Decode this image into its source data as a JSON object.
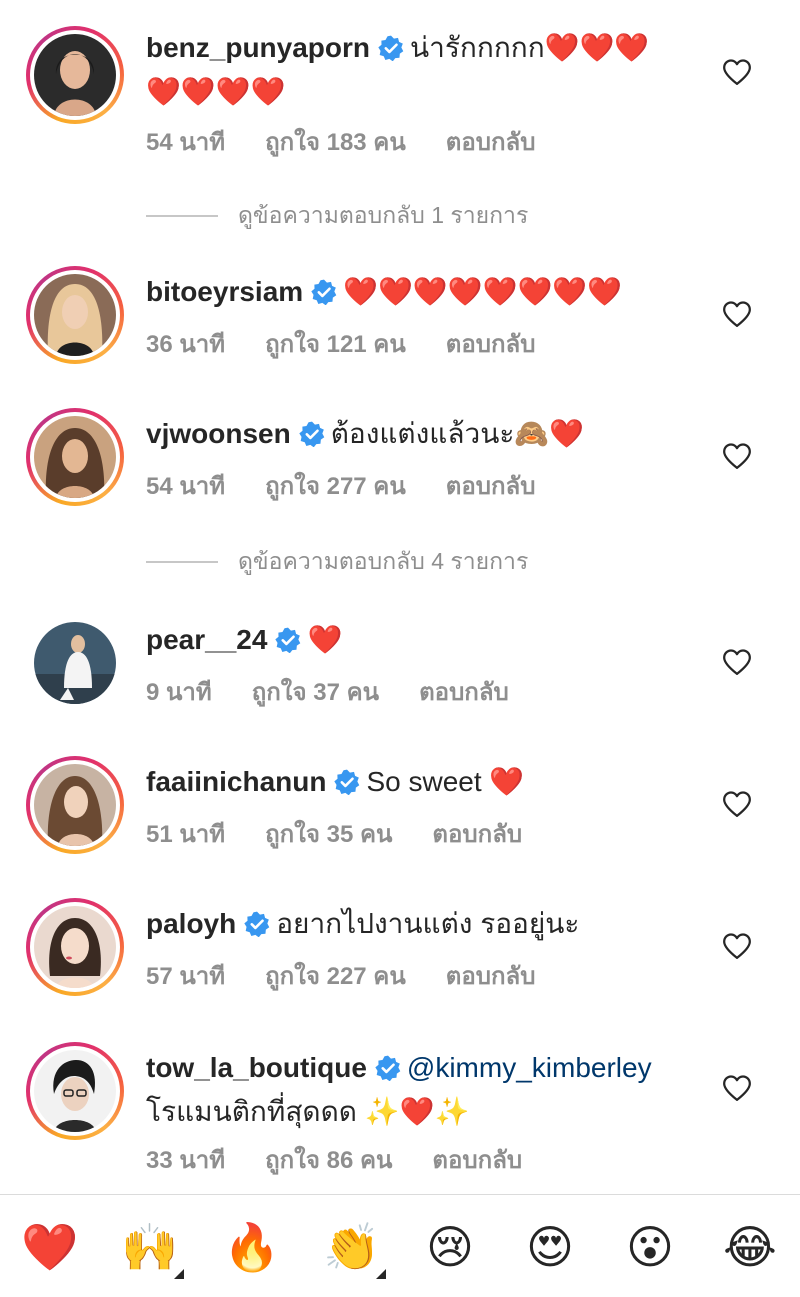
{
  "comments": [
    {
      "username": "benz_punyaporn",
      "text_line1": "น่ารักกกกก❤️❤️❤️",
      "text_line2": "❤️❤️❤️❤️",
      "time": "54 นาที",
      "likes": "ถูกใจ 183 คน",
      "reply": "ตอบกลับ",
      "ring": true
    },
    {
      "username": "bitoeyrsiam",
      "text_line1": "❤️❤️❤️❤️❤️❤️❤️❤️",
      "time": "36 นาที",
      "likes": "ถูกใจ 121 คน",
      "reply": "ตอบกลับ",
      "ring": true
    },
    {
      "username": "vjwoonsen",
      "text_line1": "ต้องแต่งแล้วนะ🙈❤️",
      "time": "54 นาที",
      "likes": "ถูกใจ 277 คน",
      "reply": "ตอบกลับ",
      "ring": true
    },
    {
      "username": "pear__24",
      "text_line1": "❤️",
      "time": "9 นาที",
      "likes": "ถูกใจ 37 คน",
      "reply": "ตอบกลับ",
      "ring": false
    },
    {
      "username": "faaiinichanun",
      "text_line1": "So sweet ❤️",
      "time": "51 นาที",
      "likes": "ถูกใจ 35 คน",
      "reply": "ตอบกลับ",
      "ring": true
    },
    {
      "username": "paloyh",
      "text_line1": "อยากไปงานแต่ง รออยู่นะ",
      "time": "57 นาที",
      "likes": "ถูกใจ 227 คน",
      "reply": "ตอบกลับ",
      "ring": true
    },
    {
      "username": "tow_la_boutique",
      "mention": "@kimmy_kimberley",
      "text_line2": "โรแมนติกที่สุดดด ✨❤️✨",
      "time": "33 นาที",
      "likes": "ถูกใจ 86 คน",
      "reply": "ตอบกลับ",
      "ring": true
    }
  ],
  "view_replies": [
    {
      "label": "ดูข้อความตอบกลับ 1 รายการ"
    },
    {
      "label": "ดูข้อความตอบกลับ 4 รายการ"
    }
  ],
  "quick_reactions": [
    "❤️",
    "🙌",
    "🔥",
    "👏",
    "😢",
    "😍",
    "😮",
    "😂"
  ],
  "colors": {
    "verified": "#3897f0",
    "meta": "#8e8e8e",
    "mention": "#00376b",
    "heart": "#e0142a"
  },
  "icons": [
    "verified-badge-icon",
    "like-heart-icon"
  ]
}
